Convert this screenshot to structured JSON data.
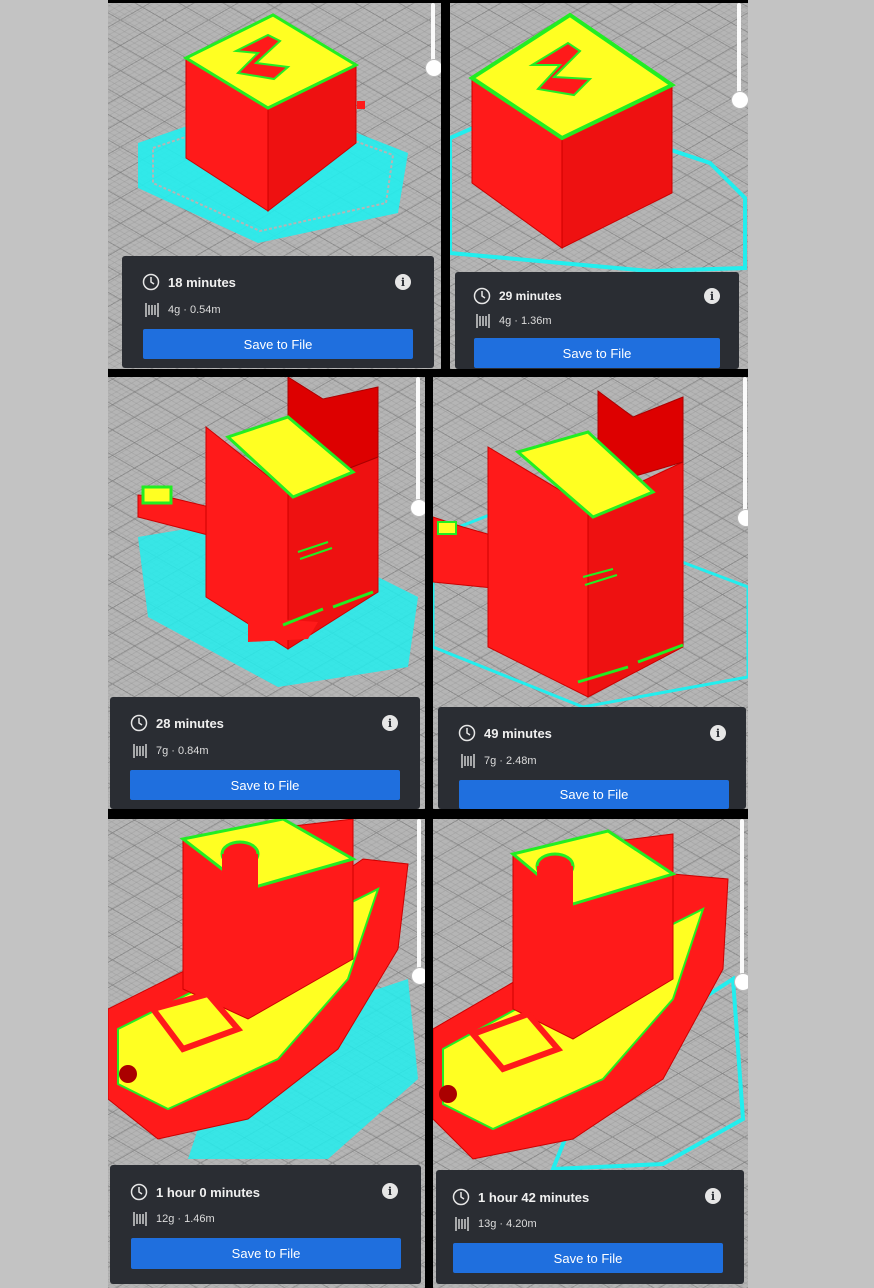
{
  "panels": [
    {
      "time": "18 minutes",
      "material": "4g · 0.54m",
      "save_label": "Save to File",
      "info": "i"
    },
    {
      "time": "29 minutes",
      "material": "4g · 1.36m",
      "save_label": "Save to File",
      "info": "i"
    },
    {
      "time": "28 minutes",
      "material": "7g · 0.84m",
      "save_label": "Save to File",
      "info": "i"
    },
    {
      "time": "49 minutes",
      "material": "7g · 2.48m",
      "save_label": "Save to File",
      "info": "i"
    },
    {
      "time": "1 hour 0 minutes",
      "material": "12g · 1.46m",
      "save_label": "Save to File",
      "info": "i"
    },
    {
      "time": "1 hour 42 minutes",
      "material": "13g · 4.20m",
      "save_label": "Save to File",
      "info": "i"
    }
  ],
  "icons": {
    "time": "clock-icon",
    "material": "filament-spool-icon",
    "info": "info-icon"
  },
  "colors": {
    "card_bg": "#2a2d33",
    "button": "#1f6fde",
    "model_red": "#ff1a1a",
    "top_yellow": "#ffff22",
    "outline_green": "#22ee22",
    "skirt_cyan": "#22eeee",
    "build_plate": "#b5b5b5"
  },
  "models": [
    "cube-with-z",
    "cube-with-z",
    "cat",
    "cat",
    "benchy",
    "benchy"
  ]
}
